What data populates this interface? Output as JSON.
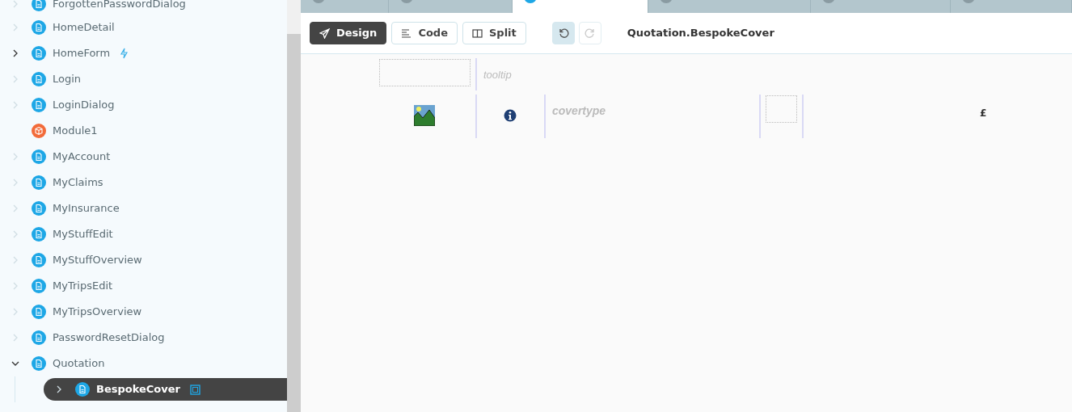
{
  "sidebar": {
    "items": [
      {
        "label": "ForgottenPasswordDialog",
        "kind": "page",
        "has_children": false,
        "expanded": false,
        "selected": false
      },
      {
        "label": "HomeDetail",
        "kind": "page",
        "has_children": false,
        "expanded": false,
        "selected": false
      },
      {
        "label": "HomeForm",
        "kind": "page",
        "has_children": true,
        "expanded": false,
        "selected": false,
        "badge": {
          "kind": "lightning"
        }
      },
      {
        "label": "Login",
        "kind": "page",
        "has_children": false,
        "expanded": false,
        "selected": false
      },
      {
        "label": "LoginDialog",
        "kind": "page",
        "has_children": false,
        "expanded": false,
        "selected": false
      },
      {
        "label": "Module1",
        "kind": "module",
        "selected": false
      },
      {
        "label": "MyAccount",
        "kind": "page",
        "has_children": false,
        "expanded": false,
        "selected": false
      },
      {
        "label": "MyClaims",
        "kind": "page",
        "has_children": false,
        "expanded": false,
        "selected": false
      },
      {
        "label": "MyInsurance",
        "kind": "page",
        "has_children": false,
        "expanded": false,
        "selected": false
      },
      {
        "label": "MyStuffEdit",
        "kind": "page",
        "has_children": false,
        "expanded": false,
        "selected": false
      },
      {
        "label": "MyStuffOverview",
        "kind": "page",
        "has_children": false,
        "expanded": false,
        "selected": false
      },
      {
        "label": "MyTripsEdit",
        "kind": "page",
        "has_children": false,
        "expanded": false,
        "selected": false
      },
      {
        "label": "MyTripsOverview",
        "kind": "page",
        "has_children": false,
        "expanded": false,
        "selected": false
      },
      {
        "label": "PasswordResetDialog",
        "kind": "page",
        "has_children": false,
        "expanded": false,
        "selected": false
      },
      {
        "label": "Quotation",
        "kind": "page",
        "has_children": true,
        "expanded": true,
        "selected": false,
        "children": [
          {
            "label": "BespokeCover",
            "kind": "page",
            "has_children": false,
            "expanded": false,
            "selected": true,
            "badge": {
              "kind": "frame"
            }
          }
        ]
      }
    ]
  },
  "tabs": [
    {
      "selected": false
    },
    {
      "selected": false
    },
    {
      "selected": true
    },
    {
      "selected": false
    },
    {
      "selected": false
    },
    {
      "selected": false
    }
  ],
  "toolbar": {
    "modes": [
      {
        "label": "Design",
        "selected": true
      },
      {
        "label": "Code",
        "selected": false
      },
      {
        "label": "Split",
        "selected": false
      }
    ],
    "undo_enabled": true,
    "redo_enabled": false,
    "title": "Quotation.BespokeCover"
  },
  "canvas": {
    "tooltip_label": "tooltip",
    "covertype_label": "covertype",
    "currency_symbol": "£"
  }
}
